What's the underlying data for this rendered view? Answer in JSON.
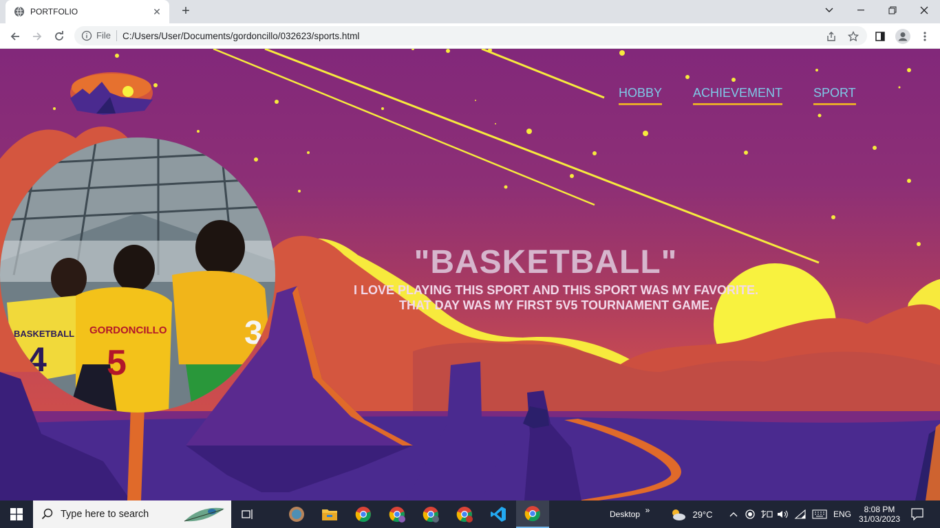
{
  "browser": {
    "tab_title": "PORTFOLIO",
    "new_tab": "+",
    "omnibox_scheme": "File",
    "url": "C:/Users/User/Documents/gordoncillo/032623/sports.html"
  },
  "nav": {
    "items": [
      {
        "label": "HOBBY"
      },
      {
        "label": "ACHIEVEMENT"
      },
      {
        "label": "SPORT"
      }
    ]
  },
  "hero": {
    "title": "\"BASKETBALL\"",
    "line1": "I LOVE PLAYING THIS SPORT AND THIS SPORT WAS MY FAVORITE.",
    "line2": "THAT DAY WAS MY FIRST 5V5 TOURNAMENT GAME."
  },
  "photo": {
    "jersey_left": "BASKETBALL",
    "jersey_left_number": "4",
    "jersey_center": "GORDONCILLO",
    "jersey_center_number": "5",
    "jersey_right_number": "3"
  },
  "taskbar": {
    "search_placeholder": "Type here to search",
    "desktop_label": "Desktop",
    "more": "»",
    "weather": "29°C",
    "language": "ENG",
    "time": "8:08 PM",
    "date": "31/03/2023"
  },
  "colors": {
    "accent_nav": "#7ecbe8",
    "underline": "#e6a92a",
    "sun": "#f8f23f",
    "mountain": "#4a2a8f",
    "cloud": "#d4563f"
  }
}
